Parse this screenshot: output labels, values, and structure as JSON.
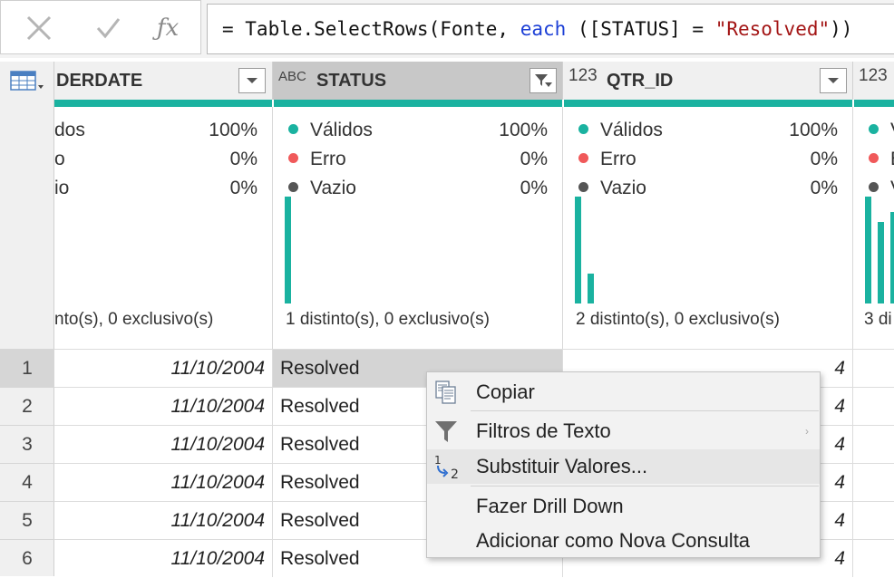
{
  "formula_bar": {
    "prefix": "= Table.SelectRows(Fonte, ",
    "keyword": "each",
    "middle": " ([STATUS] = ",
    "string": "\"Resolved\"",
    "suffix": "))"
  },
  "columns": {
    "orderdate": {
      "title": "DERDATE"
    },
    "status": {
      "type": "ABC",
      "title": "STATUS"
    },
    "qtr_id": {
      "type": "123",
      "title": "QTR_ID"
    },
    "next": {
      "type": "123"
    }
  },
  "profile_labels": {
    "valid": "Válidos",
    "error": "Erro",
    "empty": "Vazio"
  },
  "profile_colors": {
    "valid": "#1ab2a0",
    "error": "#f0595a",
    "empty": "#555555"
  },
  "profiles": {
    "orderdate": {
      "valid_label": "dos",
      "error_label": "o",
      "empty_label": "io",
      "valid_pct": "100%",
      "error_pct": "0%",
      "empty_pct": "0%",
      "distinct": "nto(s), 0 exclusivo(s)"
    },
    "status": {
      "valid_pct": "100%",
      "error_pct": "0%",
      "empty_pct": "0%",
      "distinct": "1 distinto(s), 0 exclusivo(s)",
      "histogram": [
        1.0
      ]
    },
    "qtr_id": {
      "valid_pct": "100%",
      "error_pct": "0%",
      "empty_pct": "0%",
      "distinct": "2 distinto(s), 0 exclusivo(s)",
      "histogram": [
        1.0,
        0.28
      ]
    },
    "next": {
      "valid_label": "V",
      "error_label": "E",
      "empty_label": "V",
      "distinct": "3 di",
      "histogram": [
        1.0,
        0.76,
        0.86,
        0.48
      ]
    }
  },
  "rows": [
    {
      "num": "1",
      "orderdate": "11/10/2004",
      "status": "Resolved",
      "qtr_id": "4"
    },
    {
      "num": "2",
      "orderdate": "11/10/2004",
      "status": "Resolved",
      "qtr_id": "4"
    },
    {
      "num": "3",
      "orderdate": "11/10/2004",
      "status": "Resolved",
      "qtr_id": "4"
    },
    {
      "num": "4",
      "orderdate": "11/10/2004",
      "status": "Resolved",
      "qtr_id": "4"
    },
    {
      "num": "5",
      "orderdate": "11/10/2004",
      "status": "Resolved",
      "qtr_id": "4"
    },
    {
      "num": "6",
      "orderdate": "11/10/2004",
      "status": "Resolved",
      "qtr_id": "4"
    }
  ],
  "selected_row": 0,
  "context_menu": {
    "items": [
      {
        "label": "Copiar",
        "icon": "copy-icon"
      },
      {
        "label": "Filtros de Texto",
        "icon": "filter-icon",
        "submenu": true
      },
      {
        "label": "Substituir Valores...",
        "icon": "replace-values-icon"
      },
      {
        "label": "Fazer Drill Down"
      },
      {
        "label": "Adicionar como Nova Consulta"
      }
    ],
    "hover_index": 2
  }
}
